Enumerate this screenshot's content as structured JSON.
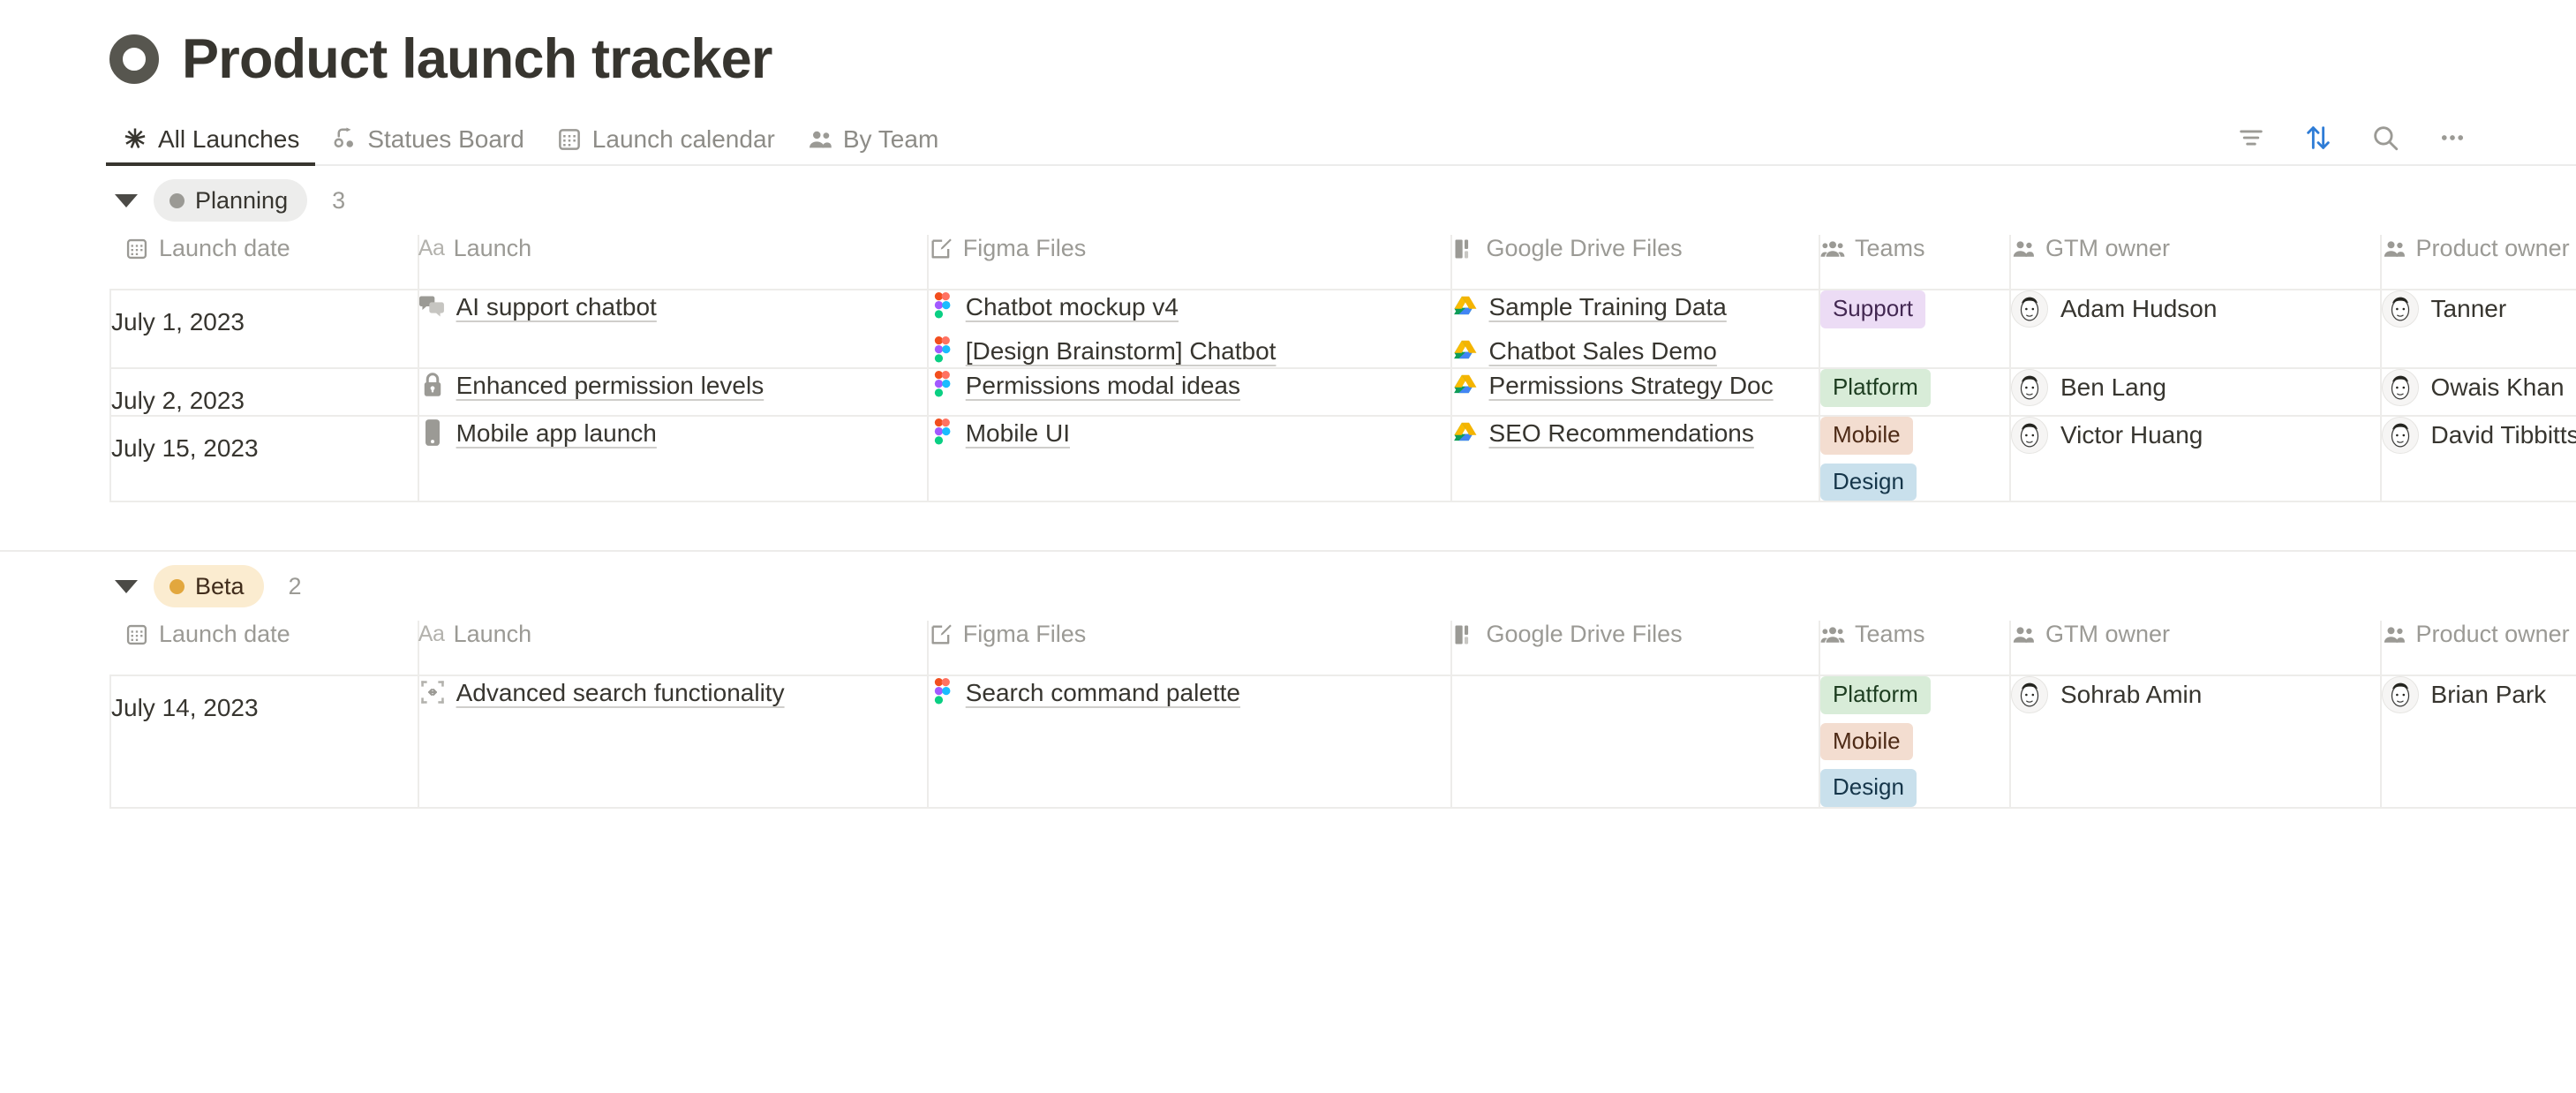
{
  "header": {
    "icon": "circle-outline-icon",
    "title": "Product launch tracker"
  },
  "tabs": [
    {
      "label": "All Launches",
      "icon": "asterisk-icon",
      "active": true
    },
    {
      "label": "Statues Board",
      "icon": "board-icon",
      "active": false
    },
    {
      "label": "Launch calendar",
      "icon": "calendar-icon",
      "active": false
    },
    {
      "label": "By Team",
      "icon": "people-icon",
      "active": false
    }
  ],
  "toolbar": [
    {
      "name": "filter-icon",
      "label": "Filter",
      "active": false
    },
    {
      "name": "sort-icon",
      "label": "Sort",
      "active": true
    },
    {
      "name": "search-icon",
      "label": "Search",
      "active": false
    },
    {
      "name": "more-options-icon",
      "label": "More options",
      "active": false
    }
  ],
  "columns": [
    {
      "key": "launch_date",
      "label": "Launch date",
      "icon": "calendar-icon"
    },
    {
      "key": "launch",
      "label": "Launch",
      "icon": "text-aa-icon"
    },
    {
      "key": "figma",
      "label": "Figma Files",
      "icon": "edit-square-icon"
    },
    {
      "key": "gdrive",
      "label": "Google Drive Files",
      "icon": "drive-files-icon"
    },
    {
      "key": "teams",
      "label": "Teams",
      "icon": "people-group-icon"
    },
    {
      "key": "gtm_owner",
      "label": "GTM owner",
      "icon": "people-icon"
    },
    {
      "key": "product_owner",
      "label": "Product owner",
      "icon": "people-icon"
    }
  ],
  "team_colors": {
    "Support": {
      "bg": "#ecdcf5",
      "fg": "#432852"
    },
    "Platform": {
      "bg": "#d8ecd8",
      "fg": "#1d3d20"
    },
    "Mobile": {
      "bg": "#f3ddd0",
      "fg": "#4d2a16"
    },
    "Design": {
      "bg": "#c9e0ec",
      "fg": "#16364a"
    }
  },
  "groups": [
    {
      "name": "Planning",
      "count": "3",
      "pill_bg": "#ededec",
      "pill_fg": "#37352f",
      "dot_color": "#9b9a95",
      "expanded": true,
      "rows": [
        {
          "launch_date": "July 1, 2023",
          "launch": {
            "text": "AI support chatbot",
            "icon": "speech-bubbles-icon"
          },
          "figma": [
            "Chatbot mockup v4",
            "[Design Brainstorm] Chatbot"
          ],
          "gdrive": [
            "Sample Training Data",
            "Chatbot Sales Demo"
          ],
          "teams": [
            "Support"
          ],
          "gtm_owner": "Adam Hudson",
          "product_owner": "Tanner"
        },
        {
          "launch_date": "July 2, 2023",
          "launch": {
            "text": "Enhanced permission levels",
            "icon": "lock-icon"
          },
          "figma": [
            "Permissions modal ideas"
          ],
          "gdrive": [
            "Permissions Strategy Doc"
          ],
          "teams": [
            "Platform"
          ],
          "gtm_owner": "Ben Lang",
          "product_owner": "Owais Khan"
        },
        {
          "launch_date": "July 15, 2023",
          "launch": {
            "text": "Mobile app launch",
            "icon": "mobile-phone-icon"
          },
          "figma": [
            "Mobile UI"
          ],
          "gdrive": [
            "SEO Recommendations"
          ],
          "teams": [
            "Mobile",
            "Design"
          ],
          "gtm_owner": "Victor Huang",
          "product_owner": "David Tibbitts"
        }
      ]
    },
    {
      "name": "Beta",
      "count": "2",
      "pill_bg": "#fbecd0",
      "pill_fg": "#402c1b",
      "dot_color": "#e2a73e",
      "expanded": true,
      "rows": [
        {
          "launch_date": "July 14, 2023",
          "launch": {
            "text": "Advanced search functionality",
            "icon": "expand-arrows-icon"
          },
          "figma": [
            "Search command palette"
          ],
          "gdrive": [],
          "teams": [
            "Platform",
            "Mobile",
            "Design"
          ],
          "gtm_owner": "Sohrab Amin",
          "product_owner": "Brian Park"
        }
      ]
    }
  ]
}
